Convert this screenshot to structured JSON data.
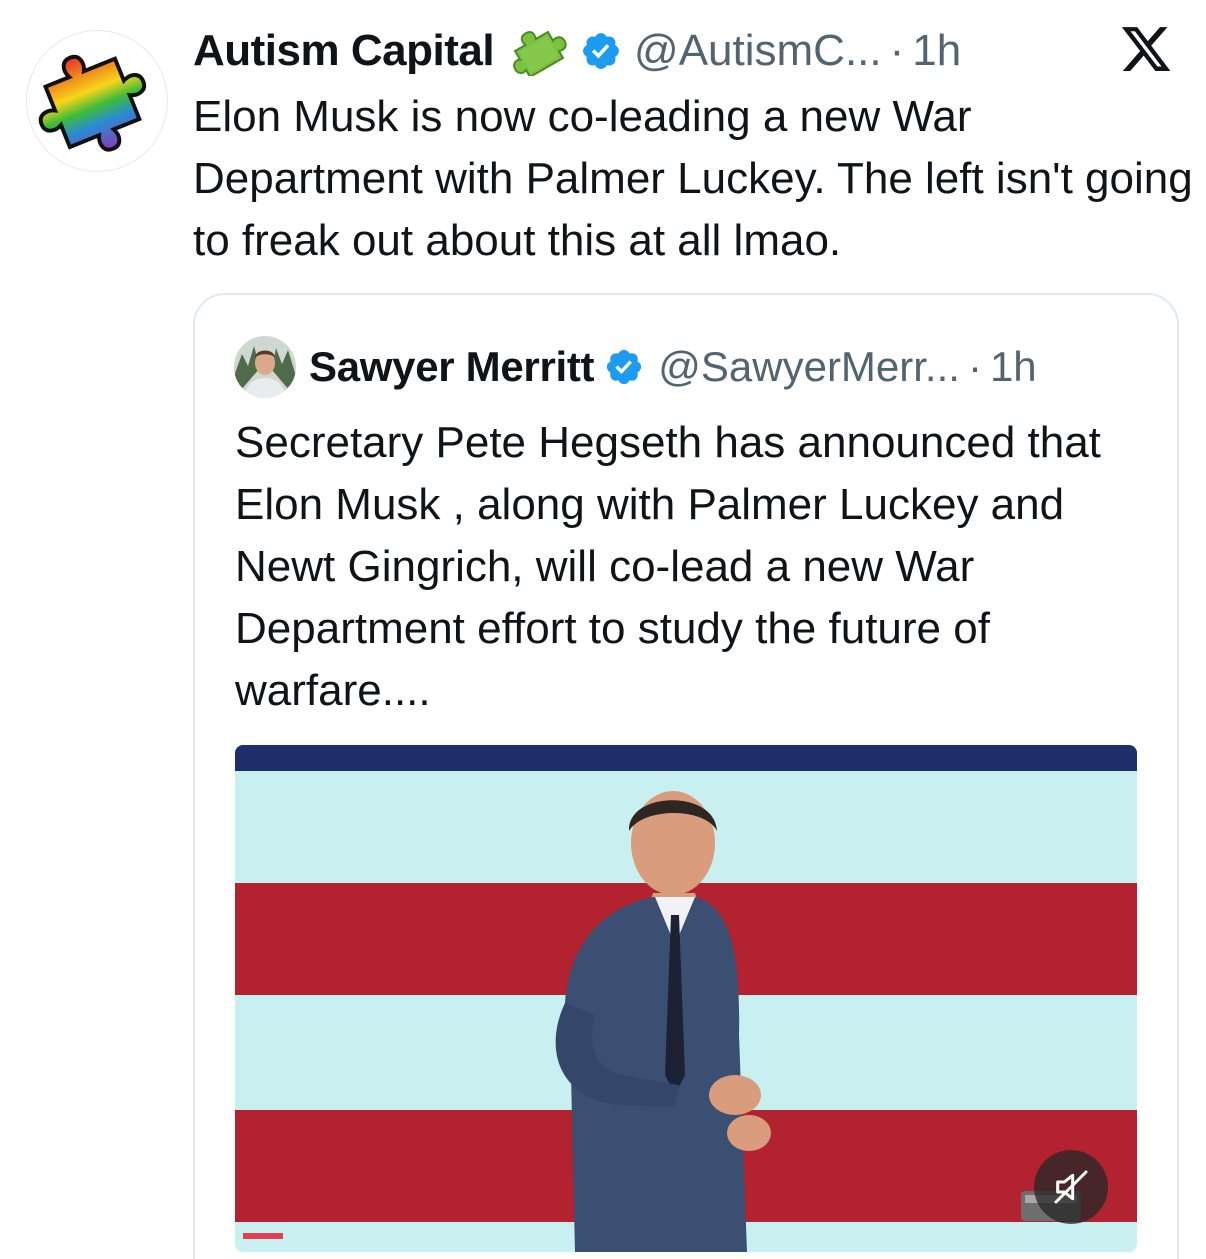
{
  "tweet": {
    "author": {
      "display_name": "Autism Capital",
      "emoji": "puzzle-piece",
      "handle": "@AutismC...",
      "time": "1h",
      "avatar_icon": "rainbow-puzzle-avatar"
    },
    "dot": "·",
    "text": "Elon Musk is now co-leading a new War Department with Palmer Luckey. The left isn't going to freak out about this at all lmao."
  },
  "quote": {
    "author": {
      "display_name": "Sawyer Merritt",
      "handle": "@SawyerMerr...",
      "time": "1h",
      "avatar_icon": "profile-photo"
    },
    "dot": "·",
    "text": "Secretary Pete Hegseth has announced that Elon Musk , along with Palmer Luckey and Newt Gingrich, will co-lead a new War Department effort to study the future of warfare....",
    "media": {
      "type": "video",
      "mute_icon": "speaker-muted-icon"
    }
  },
  "brand": {
    "logo_icon": "x-logo-icon",
    "verified_color": "#1d9bf0",
    "text_color": "#0f1419",
    "secondary_text_color": "#536471"
  }
}
